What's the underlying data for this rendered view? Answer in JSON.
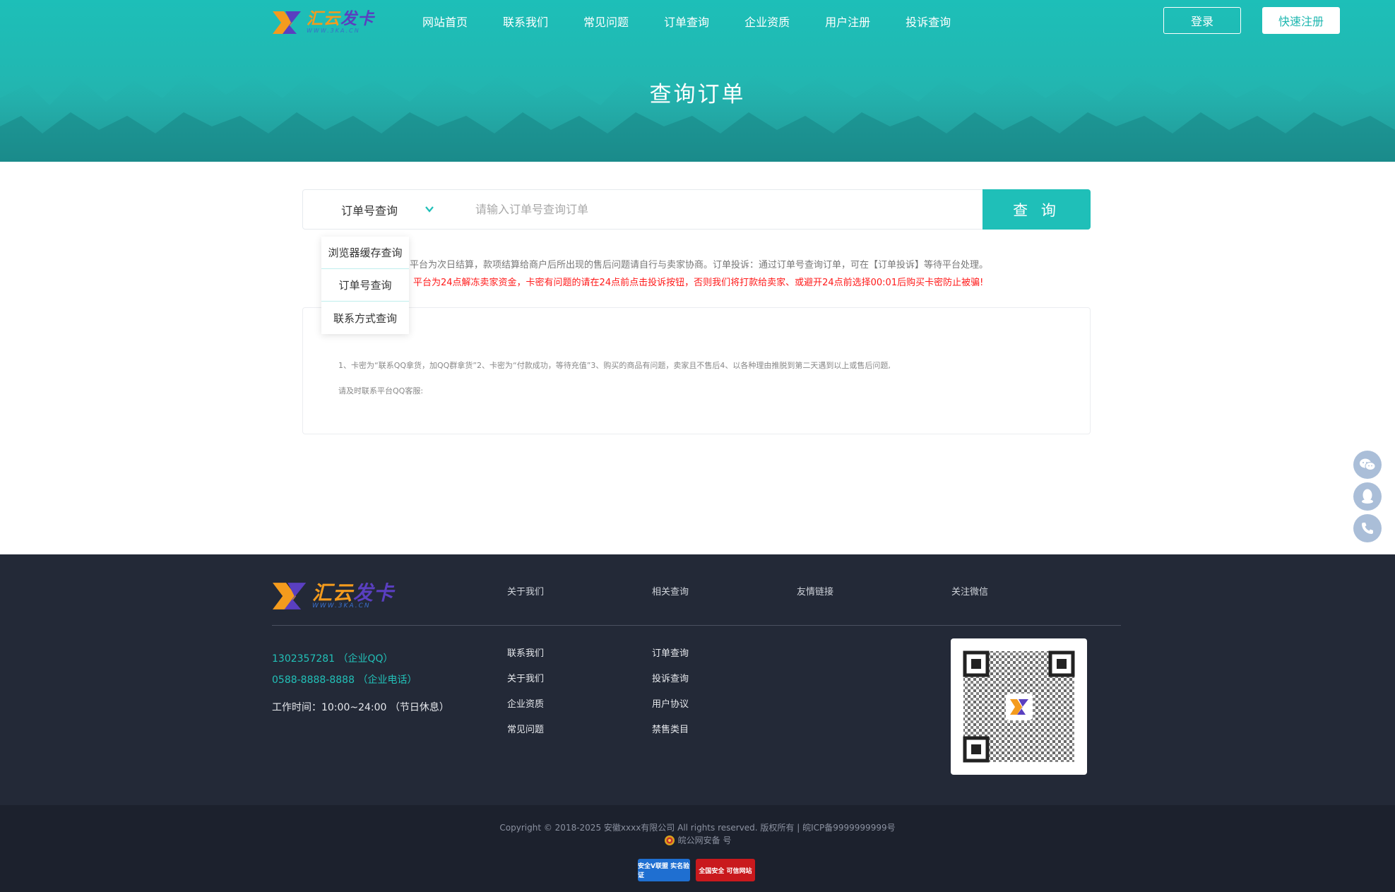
{
  "brand": {
    "name_part1": "汇云",
    "name_part2": "发卡",
    "url": "WWW.3KA.CN"
  },
  "nav": {
    "links": [
      "网站首页",
      "联系我们",
      "常见问题",
      "订单查询",
      "企业资质",
      "用户注册",
      "投诉查询"
    ],
    "login": "登录",
    "register": "快速注册"
  },
  "hero": {
    "title": "查询订单"
  },
  "search": {
    "selected": "订单号查询",
    "placeholder": "请输入订单号查询订单",
    "button": "查 询",
    "dropdown": [
      "浏览器缓存查询",
      "订单号查询",
      "联系方式查询"
    ]
  },
  "notice": {
    "line1": "平台为次日结算，款项结算给商户后所出现的售后问题请自行与卖家协商。订单投诉：通过订单号查询订单，可在【订单投诉】等待平台处理。",
    "line2": "平台为24点解冻卖家资金，卡密有问题的请在24点前点击投诉按钮，否则我们将打款给卖家、或避开24点前选择00:01后购买卡密防止被骗!"
  },
  "info_box": {
    "line1": "1、卡密为“联系QQ拿货，加QQ群拿货”2、卡密为“付款成功，等待充值”3、购买的商品有问题，卖家且不售后4、以各种理由推脱到第二天遇到以上或售后问题,",
    "line2": "请及时联系平台QQ客服:"
  },
  "footer": {
    "headings": {
      "about": "关于我们",
      "related": "相关查询",
      "links": "友情链接",
      "wechat": "关注微信"
    },
    "qq": "1302357281 （企业QQ）",
    "phone": "0588-8888-8888 （企业电话）",
    "hours": "工作时间：10:00~24:00 （节日休息）",
    "about_links": [
      "联系我们",
      "关于我们",
      "企业资质",
      "常见问题"
    ],
    "query_links": [
      "订单查询",
      "投诉查询",
      "用户协议",
      "禁售类目"
    ],
    "copyright": "Copyright © 2018-2025 安徽xxxx有限公司 All rights reserved. 版权所有 | 皖ICP备9999999999号",
    "police": "皖公网安备 号",
    "badge1": "安全V联盟 实名验证",
    "badge2": "全国安全 可信网站"
  },
  "icons": [
    "wechat-icon",
    "qq-icon",
    "phone-icon",
    "chevron-down-icon",
    "police-emblem-icon"
  ],
  "colors": {
    "accent": "#1fbfb8",
    "warning": "#ff1a1a",
    "footer_bg": "#232937",
    "float_btn": "#aabed8"
  }
}
